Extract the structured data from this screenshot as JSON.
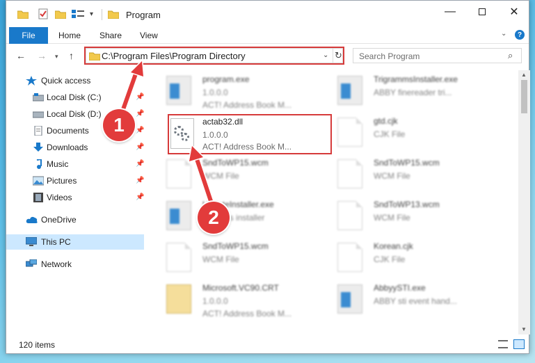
{
  "window": {
    "title": "Program",
    "qat_icons": [
      "folder-icon",
      "checkmark-icon",
      "folder-icon",
      "properties-icon",
      "caret-down-icon"
    ]
  },
  "ribbon": {
    "tabs": [
      {
        "label": "File",
        "active": true
      },
      {
        "label": "Home"
      },
      {
        "label": "Share"
      },
      {
        "label": "View"
      }
    ]
  },
  "nav": {
    "address": "C:\\Program Files\\Program Directory",
    "search_placeholder": "Search Program"
  },
  "sidebar": {
    "items": [
      {
        "label": "Quick access",
        "icon": "star-icon",
        "pinned": false
      },
      {
        "label": "Local Disk (C:)",
        "icon": "drive-icon",
        "pinned": true
      },
      {
        "label": "Local Disk (D:)",
        "icon": "drive-icon",
        "pinned": true
      },
      {
        "label": "Documents",
        "icon": "documents-icon",
        "pinned": true
      },
      {
        "label": "Downloads",
        "icon": "download-arrow-icon",
        "pinned": true
      },
      {
        "label": "Music",
        "icon": "music-note-icon",
        "pinned": true
      },
      {
        "label": "Pictures",
        "icon": "pictures-icon",
        "pinned": true
      },
      {
        "label": "Videos",
        "icon": "film-icon",
        "pinned": true
      },
      {
        "label": "OneDrive",
        "icon": "cloud-icon",
        "pinned": false
      },
      {
        "label": "This PC",
        "icon": "monitor-icon",
        "selected": true
      },
      {
        "label": "Network",
        "icon": "network-icon",
        "pinned": false
      }
    ]
  },
  "files": [
    {
      "name": "program.exe",
      "line2": "1.0.0.0",
      "line3": "ACT! Address Book M...",
      "thumb": "installer"
    },
    {
      "name": "TrigrammsInstaller.exe",
      "line2": "ABBY finereader tri...",
      "line3": "",
      "thumb": "installer"
    },
    {
      "name": "actab32.dll",
      "line2": "1.0.0.0",
      "line3": "ACT! Address Book M...",
      "thumb": "dll",
      "highlighted": true
    },
    {
      "name": "gtd.cjk",
      "line2": "CJK File",
      "line3": "",
      "thumb": "doc"
    },
    {
      "name": "SndToWP15.wcm",
      "line2": "WCM File",
      "line3": "",
      "thumb": "doc"
    },
    {
      "name": "SndToWP15.wcm",
      "line2": "WCM File",
      "line3": "",
      "thumb": "doc"
    },
    {
      "name": "UpdateInstaller.exe",
      "line2": "Updates installer",
      "line3": "",
      "thumb": "installer"
    },
    {
      "name": "SndToWP13.wcm",
      "line2": "WCM File",
      "line3": "",
      "thumb": "doc"
    },
    {
      "name": "SndToWP15.wcm",
      "line2": "WCM File",
      "line3": "",
      "thumb": "doc"
    },
    {
      "name": "Korean.cjk",
      "line2": "CJK File",
      "line3": "",
      "thumb": "doc"
    },
    {
      "name": "Microsoft.VC90.CRT",
      "line2": "1.0.0.0",
      "line3": "ACT! Address Book M...",
      "thumb": "cert"
    },
    {
      "name": "AbbyySTI.exe",
      "line2": "ABBY sti event hand...",
      "line3": "",
      "thumb": "installer"
    }
  ],
  "status": {
    "item_count": "120 items"
  },
  "annotations": {
    "step1": "1",
    "step2": "2",
    "accent": "#e23b3b"
  }
}
